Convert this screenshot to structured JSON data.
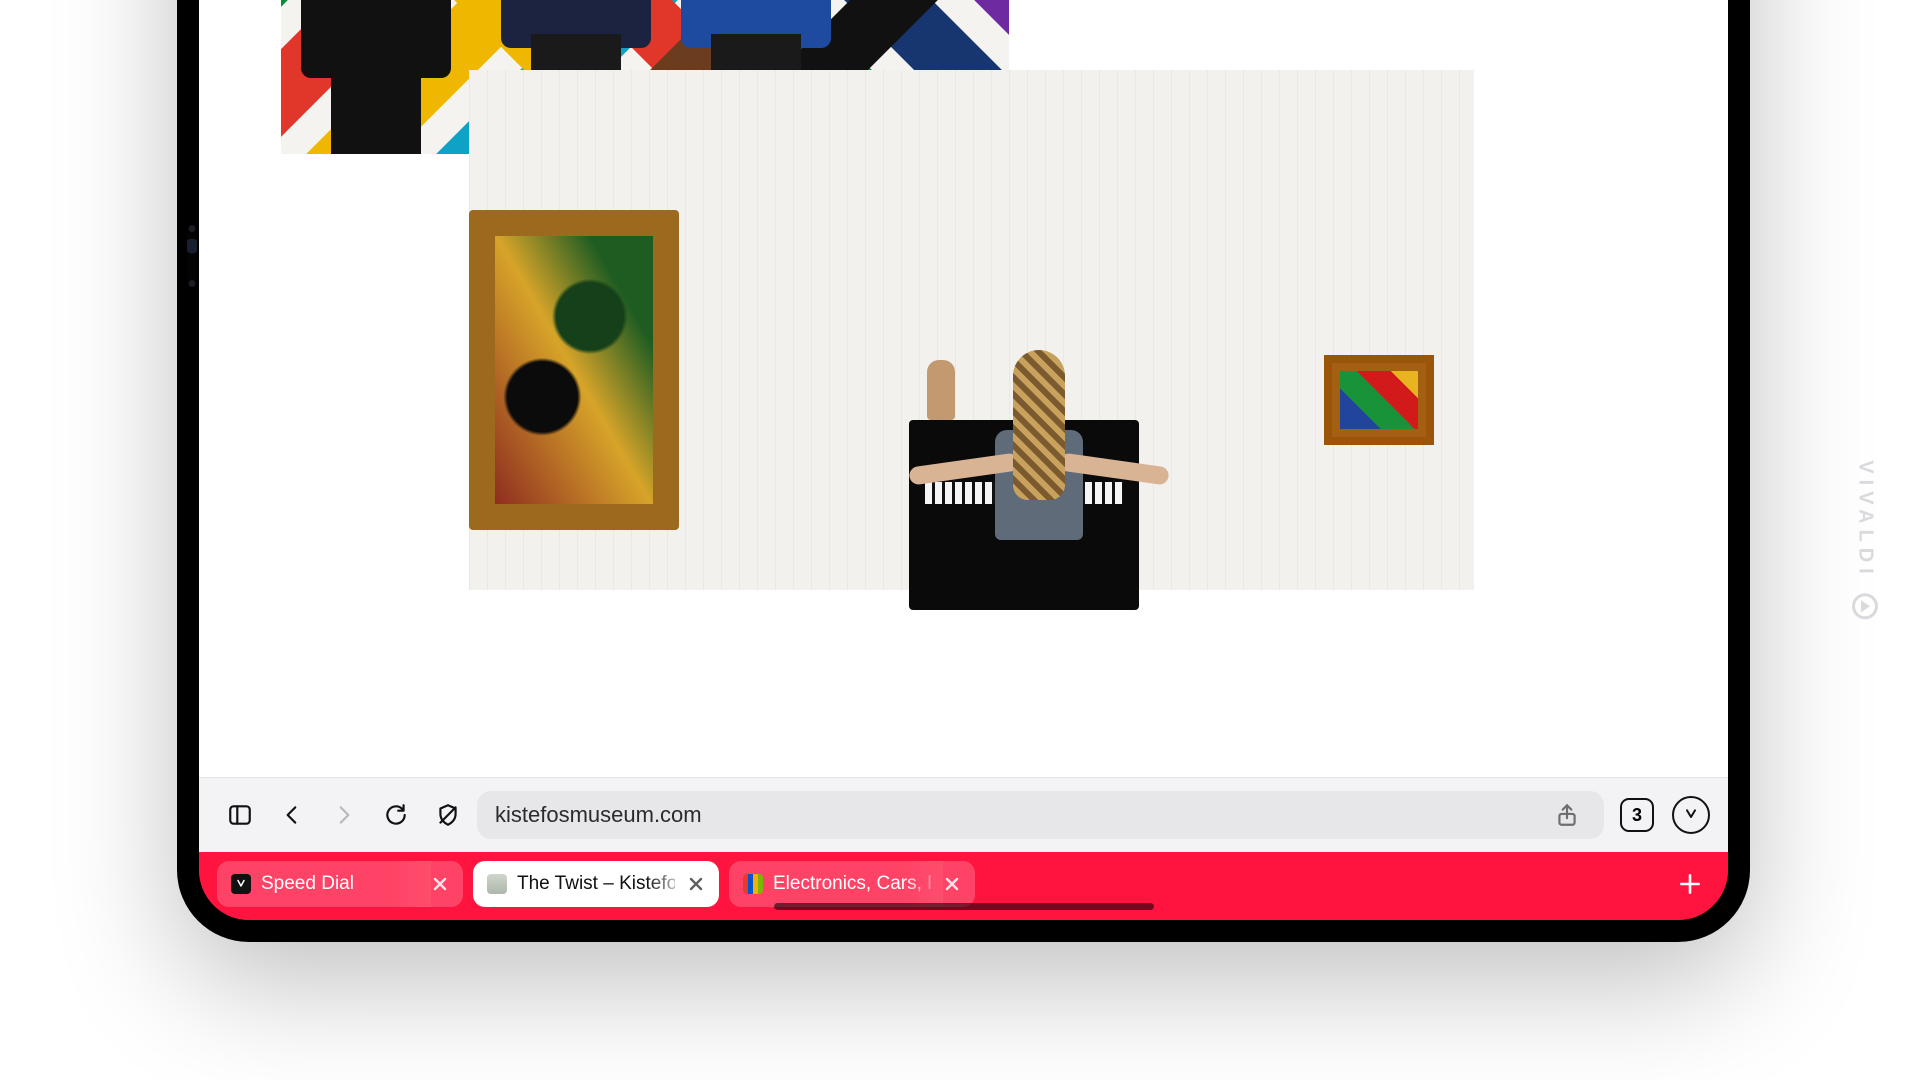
{
  "address_bar": {
    "url": "kistefosmuseum.com"
  },
  "tab_counter": "3",
  "tabs": [
    {
      "title": "Speed Dial",
      "active": false
    },
    {
      "title": "The Twist – Kistefos",
      "active": true
    },
    {
      "title": "Electronics, Cars, Fashion",
      "active": false
    }
  ],
  "watermark": "VIVALDI",
  "lattice_colors": [
    "#17356e",
    "#0c8a3c",
    "#e1362a",
    "#efb700",
    "#0ea2c6",
    "#6b3c1e",
    "#111111",
    "#6e2aa0"
  ]
}
